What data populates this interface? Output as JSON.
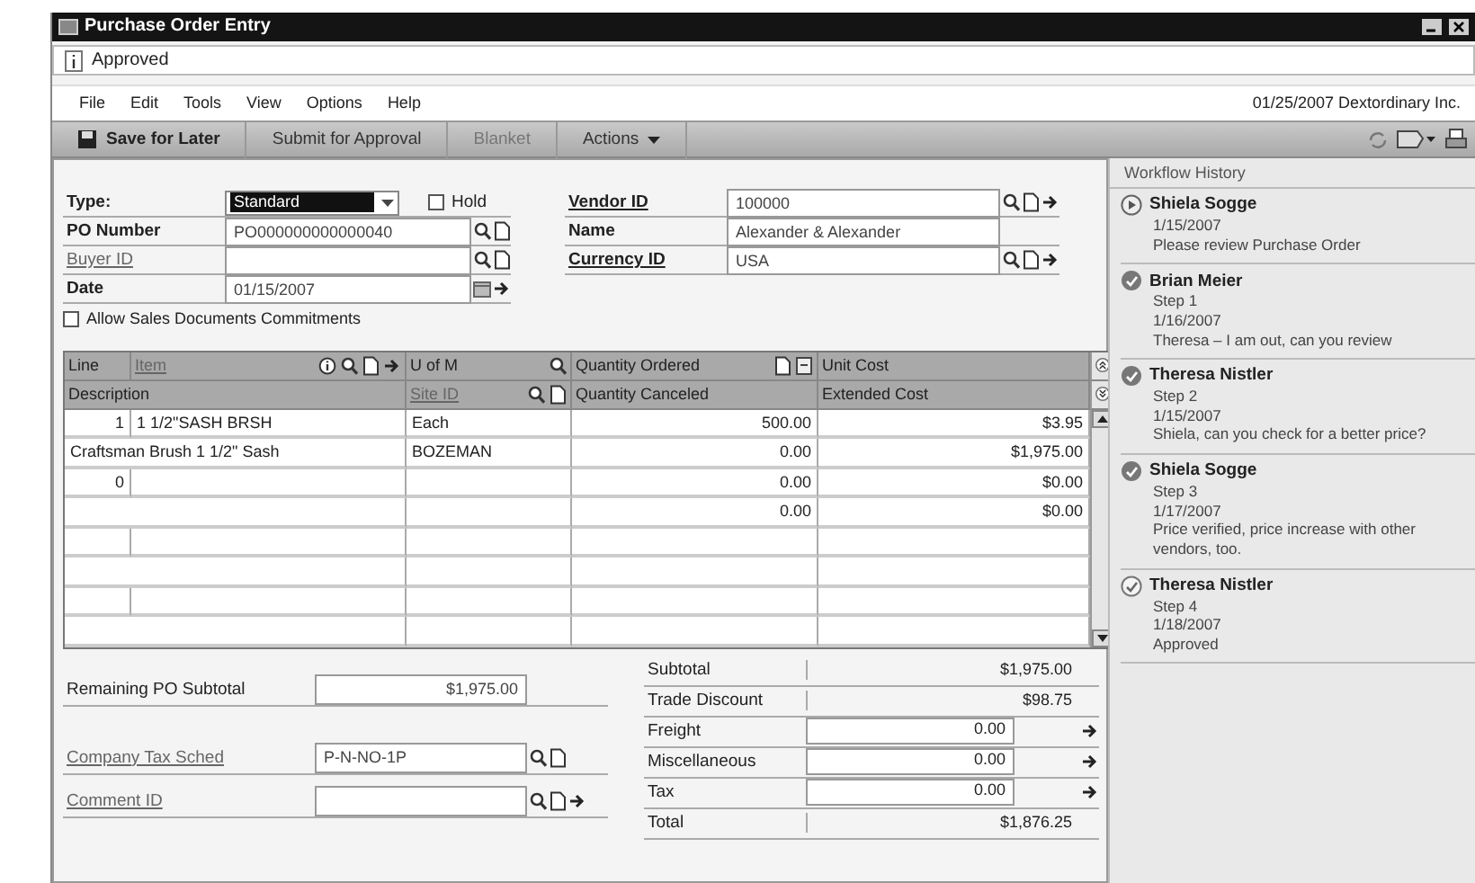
{
  "window": {
    "title": "Purchase Order Entry"
  },
  "status_note": "Approved",
  "menu": [
    "File",
    "Edit",
    "Tools",
    "View",
    "Options",
    "Help"
  ],
  "menu_info": "01/25/2007 Dextordinary Inc.",
  "toolbar": [
    {
      "kind": "save",
      "label": "Save for Later",
      "disabled": false
    },
    {
      "kind": "plain",
      "label": "Submit for Approval",
      "disabled": false
    },
    {
      "kind": "plain",
      "label": "Blanket",
      "disabled": true
    },
    {
      "kind": "menu",
      "label": "Actions",
      "disabled": false
    }
  ],
  "fields_left": [
    {
      "label": "Type:",
      "bold": true,
      "link": false,
      "kind": "dropdown",
      "value": "Standard",
      "highlighted": true
    },
    {
      "label": "PO Number",
      "bold": true,
      "link": false,
      "kind": "text",
      "value": "PO000000000000040",
      "buttons": [
        {
          "kind": "lookup"
        },
        {
          "kind": "new"
        }
      ]
    },
    {
      "label": "Buyer ID",
      "bold": false,
      "link": true,
      "kind": "text",
      "buttons": [
        {
          "kind": "lookup"
        },
        {
          "kind": "new"
        }
      ]
    },
    {
      "label": "Date",
      "bold": true,
      "link": false,
      "kind": "text",
      "value": "01/15/2007",
      "buttons": [
        {
          "kind": "calendar"
        },
        {
          "kind": "go"
        }
      ]
    }
  ],
  "hold": {
    "label": "Hold",
    "checked": false
  },
  "fields_right": [
    {
      "label": "Vendor ID",
      "bold": true,
      "link": true,
      "kind": "text",
      "value": "100000",
      "buttons": [
        {
          "kind": "lookup"
        },
        {
          "kind": "new"
        },
        {
          "kind": "go"
        }
      ]
    },
    {
      "label": "Name",
      "bold": true,
      "link": false,
      "kind": "text",
      "value": "Alexander & Alexander"
    },
    {
      "label": "Currency ID",
      "bold": true,
      "link": true,
      "kind": "text",
      "value": "USA",
      "buttons": [
        {
          "kind": "lookup"
        },
        {
          "kind": "new"
        },
        {
          "kind": "go"
        }
      ]
    }
  ],
  "allow_commitments": {
    "label": "Allow Sales Documents Commitments",
    "checked": false
  },
  "grid": {
    "header_top": [
      {
        "label": "Line",
        "link": false
      },
      {
        "label": "Item",
        "link": true,
        "buttons": [
          {
            "kind": "info"
          },
          {
            "kind": "lookup"
          },
          {
            "kind": "new"
          },
          {
            "kind": "go"
          }
        ]
      },
      {
        "label": "U of M",
        "link": false,
        "buttons": [
          {
            "kind": "lookup"
          }
        ]
      },
      {
        "label": "Quantity Ordered",
        "link": false,
        "buttons": [
          {
            "kind": "new"
          },
          {
            "kind": "split"
          }
        ]
      },
      {
        "label": "Unit Cost",
        "link": false
      }
    ],
    "header_bottom": [
      {
        "label": "Description",
        "link": false
      },
      {
        "label": "Site ID",
        "link": true,
        "buttons": [
          {
            "kind": "lookup"
          },
          {
            "kind": "new"
          }
        ]
      },
      {
        "label": "Quantity Canceled",
        "link": false
      },
      {
        "label": "Extended Cost",
        "link": false
      }
    ],
    "rows": [
      {
        "kind": "line",
        "line": "1",
        "item": "1 1/2\"SASH BRSH",
        "uom": "Each",
        "quantity": "500.00",
        "cost": "$3.95"
      },
      {
        "kind": "detail",
        "description": "Craftsman Brush 1 1/2\" Sash",
        "site": "BOZEMAN",
        "quantity": "0.00",
        "cost": "$1,975.00"
      },
      {
        "kind": "line",
        "line": "0",
        "quantity": "0.00",
        "cost": "$0.00"
      },
      {
        "kind": "detail",
        "quantity": "0.00",
        "cost": "$0.00"
      },
      {
        "kind": "line"
      },
      {
        "kind": "detail"
      },
      {
        "kind": "line"
      },
      {
        "kind": "detail"
      }
    ]
  },
  "totals_left": [
    {
      "label": "Remaining PO Subtotal",
      "link": false,
      "value": "$1,975.00"
    },
    {
      "label": "Company Tax Sched",
      "link": true,
      "value": "P-N-NO-1P",
      "buttons": [
        {
          "kind": "lookup"
        },
        {
          "kind": "new"
        }
      ]
    },
    {
      "label": "Comment ID",
      "link": true,
      "buttons": [
        {
          "kind": "lookup"
        },
        {
          "kind": "new"
        },
        {
          "kind": "go"
        }
      ]
    }
  ],
  "totals_right": [
    {
      "label": "Subtotal",
      "value": "$1,975.00"
    },
    {
      "label": "Trade Discount",
      "value": "$98.75"
    },
    {
      "label": "Freight",
      "value": "0.00",
      "buttons": [
        {
          "kind": "go"
        }
      ]
    },
    {
      "label": "Miscellaneous",
      "value": "0.00",
      "buttons": [
        {
          "kind": "go"
        }
      ]
    },
    {
      "label": "Tax",
      "value": "0.00",
      "buttons": [
        {
          "kind": "go"
        }
      ]
    },
    {
      "label": "Total",
      "value": "$1,876.25"
    }
  ],
  "workflow": {
    "title": "Workflow History",
    "entries": [
      {
        "kind": "submitted",
        "name": "Shiela Sogge",
        "date": "1/15/2007",
        "comment": "Please review Purchase Order"
      },
      {
        "kind": "approved",
        "name": "Brian Meier",
        "step": "Step 1",
        "date": "1/16/2007",
        "comment": "Theresa – I am out, can you review"
      },
      {
        "kind": "approved",
        "name": "Theresa Nistler",
        "step": "Step 2",
        "date": "1/15/2007",
        "comment": "Shiela, can you check for a better price?"
      },
      {
        "kind": "approved",
        "name": "Shiela Sogge",
        "step": "Step 3",
        "date": "1/17/2007",
        "comment": "Price verified, price increase with other vendors, too."
      },
      {
        "kind": "final",
        "name": "Theresa Nistler",
        "step": "Step 4",
        "date": "1/18/2007",
        "comment": "Approved"
      }
    ]
  }
}
